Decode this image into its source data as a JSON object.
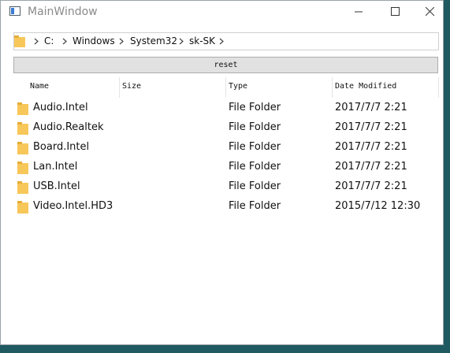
{
  "window": {
    "title": "MainWindow",
    "controls": [
      "minimize-icon",
      "maximize-icon",
      "close-icon"
    ]
  },
  "breadcrumb": {
    "segments": [
      "C:",
      "Windows",
      "System32",
      "sk-SK"
    ]
  },
  "toolbar": {
    "reset_label": "reset"
  },
  "table": {
    "columns": [
      "Name",
      "Size",
      "Type",
      "Date Modified"
    ],
    "rows": [
      {
        "name": "Audio.Intel",
        "size": "",
        "type": "File Folder",
        "date": "2017/7/7 2:21"
      },
      {
        "name": "Audio.Realtek",
        "size": "",
        "type": "File Folder",
        "date": "2017/7/7 2:21"
      },
      {
        "name": "Board.Intel",
        "size": "",
        "type": "File Folder",
        "date": "2017/7/7 2:21"
      },
      {
        "name": "Lan.Intel",
        "size": "",
        "type": "File Folder",
        "date": "2017/7/7 2:21"
      },
      {
        "name": "USB.Intel",
        "size": "",
        "type": "File Folder",
        "date": "2017/7/7 2:21"
      },
      {
        "name": "Video.Intel.HD3",
        "size": "",
        "type": "File Folder",
        "date": "2015/7/12 12:30"
      }
    ]
  },
  "colors": {
    "folder": "#f8c75a",
    "folder_dark": "#e6ad38",
    "button_bg": "#e1e1e1",
    "desktop": "#1e5a5f"
  }
}
